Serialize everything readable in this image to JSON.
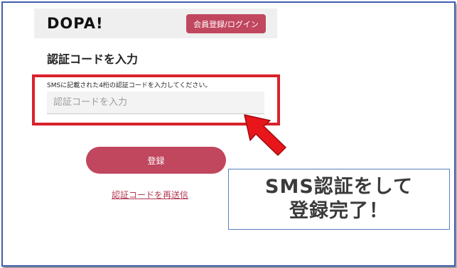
{
  "header": {
    "logo_text": "DOPA!",
    "auth_button_label": "会員登録/ログイン"
  },
  "main": {
    "title": "認証コードを入力",
    "instruction": "SMSに記載された4桁の認証コードを入力してください。",
    "code_input": {
      "value": "",
      "placeholder": "認証コードを入力"
    },
    "register_button_label": "登録",
    "resend_link_label": "認証コードを再送信"
  },
  "annotation": {
    "line1": "SMS認証をして",
    "line2": "登録完了！",
    "highlight_color": "#d9222a",
    "arrow_color": "#e8151b"
  },
  "colors": {
    "brand": "#c0475e",
    "frame_border": "#3f5fb0"
  }
}
